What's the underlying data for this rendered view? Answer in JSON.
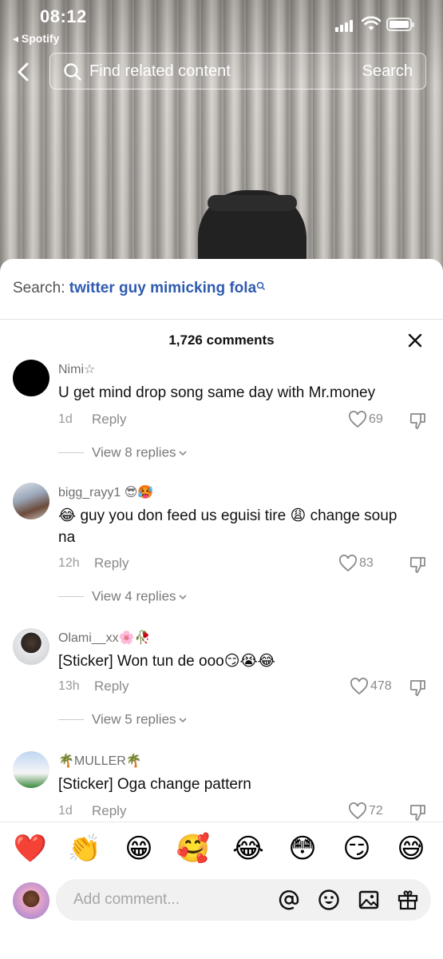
{
  "status": {
    "time": "08:12",
    "back_app": "◂ Spotify"
  },
  "top_search": {
    "placeholder": "Find related content",
    "button": "Search"
  },
  "sheet": {
    "search_prefix": "Search: ",
    "search_query": "twitter guy mimicking fola",
    "comment_count": "1,726 comments"
  },
  "comments": [
    {
      "user": "Nimi☆",
      "text": "U get mind drop song same day with Mr.money",
      "age": "1d",
      "reply": "Reply",
      "likes": "69",
      "view_replies": "View 8 replies"
    },
    {
      "user": "bigg_rayy1 😎🥵",
      "text": "😂 guy you don feed us eguisi tire 😩 change soup na",
      "age": "12h",
      "reply": "Reply",
      "likes": "83",
      "view_replies": "View 4 replies"
    },
    {
      "user": "Olami__xx🌸🥀",
      "text": "[Sticker] Won tun de ooo😏😭😂",
      "age": "13h",
      "reply": "Reply",
      "likes": "478",
      "view_replies": "View 5 replies"
    },
    {
      "user": "🌴MULLER🌴",
      "text": "[Sticker] Oga change pattern",
      "age": "1d",
      "reply": "Reply",
      "likes": "72"
    }
  ],
  "emoji_bar": [
    "❤️",
    "👏",
    "😁",
    "🥰",
    "😂",
    "😳",
    "😏",
    "😅"
  ],
  "comment_input": {
    "placeholder": "Add comment..."
  },
  "icons": {
    "back": "chevron-left-icon",
    "search": "search-icon",
    "close": "close-icon",
    "like": "heart-outline-icon",
    "dislike": "thumbs-down-icon",
    "mention": "at-sign-icon",
    "emoji": "smiley-icon",
    "image": "image-icon",
    "gift": "gift-icon"
  },
  "colors": {
    "accent_link": "#2f5bb0",
    "meta_gray": "#8a8a8a",
    "input_bg": "#f1f1f2"
  }
}
